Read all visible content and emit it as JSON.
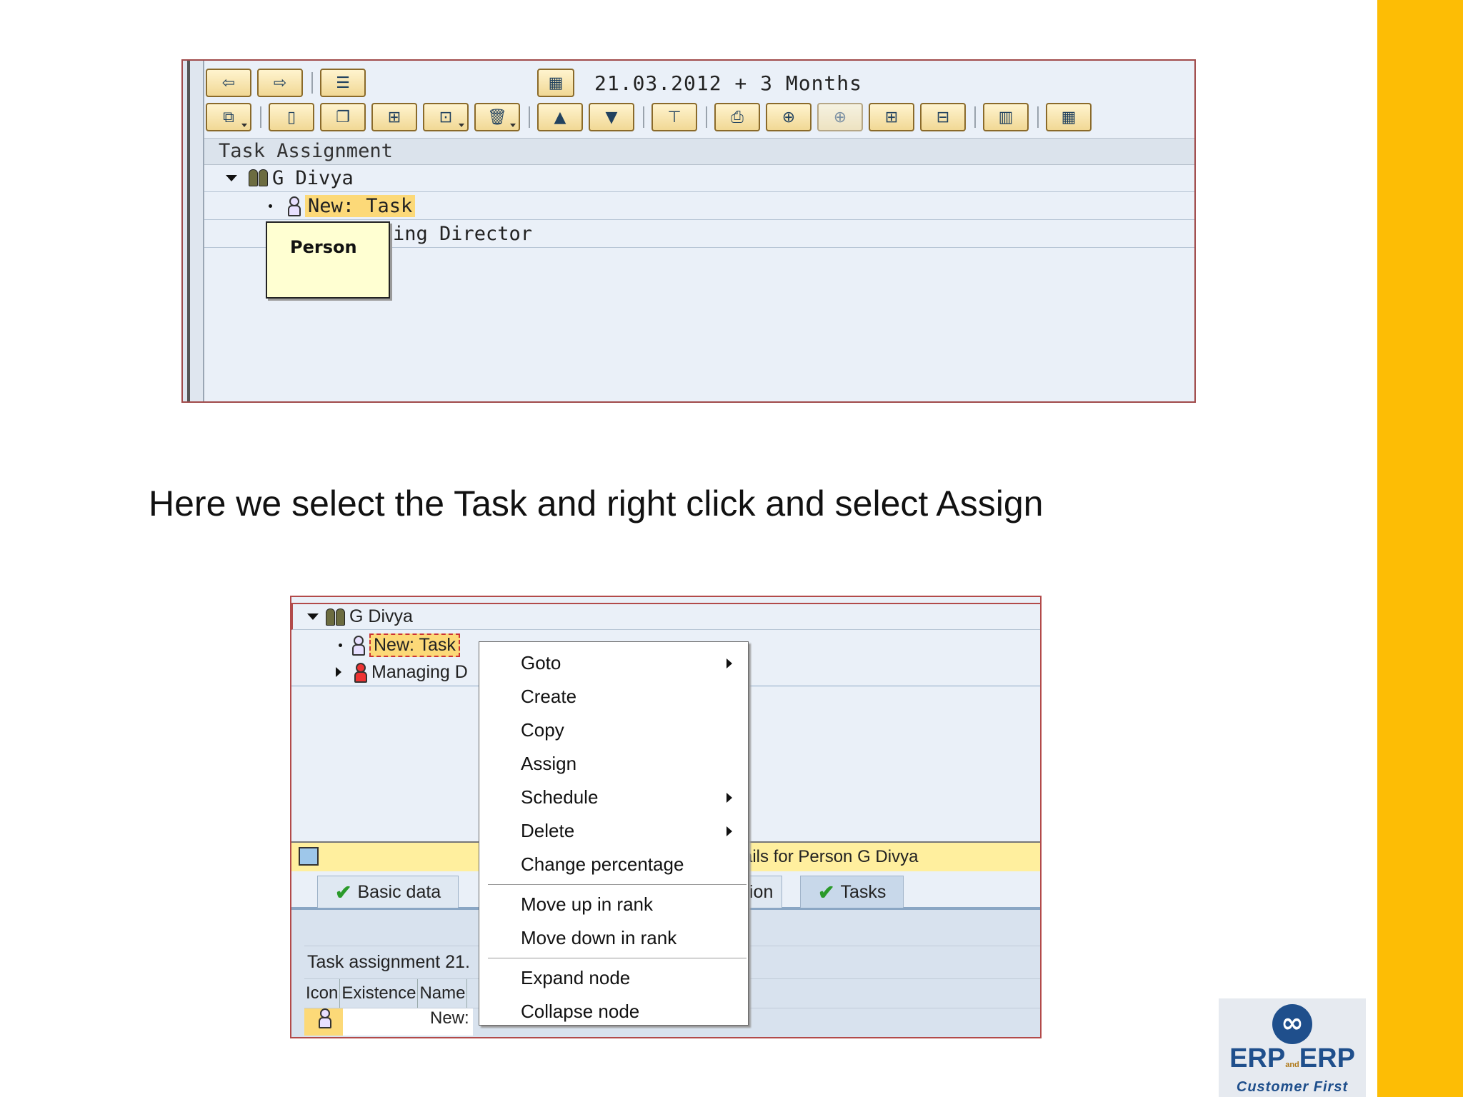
{
  "colors": {
    "accent_band": "#fdbd05",
    "highlight": "#fcd978",
    "brand": "#1f4f8c"
  },
  "shot1": {
    "date_range": "21.03.2012 + 3 Months",
    "tree_header": "Task Assignment",
    "root_label": "G Divya",
    "task_label": "New: Task",
    "director_partial": "ing Director",
    "tooltip": "Person",
    "toolbar_row1_icons": [
      "back-arrow-icon",
      "forward-arrow-icon",
      "list-icon",
      "calendar-icon"
    ],
    "toolbar_row2_icons": [
      "copy-icon",
      "new-document-icon",
      "duplicate-icon",
      "structure-icon",
      "dropdown-structure-icon",
      "delete-icon",
      "move-up-icon",
      "move-down-icon",
      "hierarchy-icon",
      "print-icon",
      "find-icon",
      "find-next-icon",
      "expand-icon",
      "collapse-icon",
      "layout-icon",
      "settings-icon"
    ]
  },
  "caption": "Here we select the Task and right click and select Assign",
  "shot2": {
    "root_label": "G Divya",
    "task_label": "New: Task",
    "managing_partial": "Managing D",
    "details_text": "ails for Person G Divya",
    "tabs": [
      {
        "label": "Basic data",
        "checked": true
      },
      {
        "label": "ion",
        "checked": false
      },
      {
        "label": "Tasks",
        "checked": true
      }
    ],
    "table_title": "Task assignment 21.",
    "columns": [
      "Icon",
      "Existence",
      "Name"
    ],
    "row_name_partial": "New:"
  },
  "context_menu": {
    "items": [
      {
        "label": "Goto",
        "submenu": true
      },
      {
        "label": "Create",
        "submenu": false
      },
      {
        "label": "Copy",
        "submenu": false
      },
      {
        "label": "Assign",
        "submenu": false
      },
      {
        "label": "Schedule",
        "submenu": true
      },
      {
        "label": "Delete",
        "submenu": true
      },
      {
        "label": "Change percentage",
        "submenu": false
      },
      {
        "label": "Move up in rank",
        "submenu": false
      },
      {
        "label": "Move down in rank",
        "submenu": false
      },
      {
        "label": "Expand node",
        "submenu": false
      },
      {
        "label": "Collapse node",
        "submenu": false
      }
    ]
  },
  "logo": {
    "main_left": "ERP",
    "and": "and",
    "main_right": "ERP",
    "tagline": "Customer First"
  }
}
